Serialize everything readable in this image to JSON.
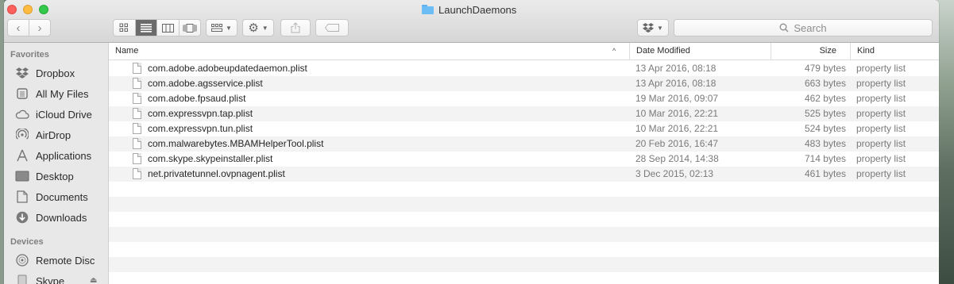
{
  "window": {
    "title": "LaunchDaemons",
    "folder_icon": "folder-icon"
  },
  "toolbar": {
    "back_icon": "chevron-left-icon",
    "forward_icon": "chevron-right-icon",
    "views": [
      "icon-view",
      "list-view",
      "column-view",
      "cover-flow-view"
    ],
    "active_view": "list-view",
    "search_placeholder": "Search"
  },
  "sidebar": {
    "favorites_label": "Favorites",
    "favorites": [
      {
        "label": "Dropbox",
        "icon": "dropbox-icon"
      },
      {
        "label": "All My Files",
        "icon": "all-files-icon"
      },
      {
        "label": "iCloud Drive",
        "icon": "cloud-icon"
      },
      {
        "label": "AirDrop",
        "icon": "airdrop-icon"
      },
      {
        "label": "Applications",
        "icon": "applications-icon"
      },
      {
        "label": "Desktop",
        "icon": "desktop-icon"
      },
      {
        "label": "Documents",
        "icon": "documents-icon"
      },
      {
        "label": "Downloads",
        "icon": "downloads-icon"
      }
    ],
    "devices_label": "Devices",
    "devices": [
      {
        "label": "Remote Disc",
        "icon": "disc-icon"
      },
      {
        "label": "Skype",
        "icon": "drive-icon"
      }
    ]
  },
  "table": {
    "columns": {
      "name": "Name",
      "date": "Date Modified",
      "size": "Size",
      "kind": "Kind"
    },
    "rows": [
      {
        "name": "com.adobe.adobeupdatedaemon.plist",
        "date": "13 Apr 2016, 08:18",
        "size": "479 bytes",
        "kind": "property list"
      },
      {
        "name": "com.adobe.agsservice.plist",
        "date": "13 Apr 2016, 08:18",
        "size": "663 bytes",
        "kind": "property list"
      },
      {
        "name": "com.adobe.fpsaud.plist",
        "date": "19 Mar 2016, 09:07",
        "size": "462 bytes",
        "kind": "property list"
      },
      {
        "name": "com.expressvpn.tap.plist",
        "date": "10 Mar 2016, 22:21",
        "size": "525 bytes",
        "kind": "property list"
      },
      {
        "name": "com.expressvpn.tun.plist",
        "date": "10 Mar 2016, 22:21",
        "size": "524 bytes",
        "kind": "property list"
      },
      {
        "name": "com.malwarebytes.MBAMHelperTool.plist",
        "date": "20 Feb 2016, 16:47",
        "size": "483 bytes",
        "kind": "property list"
      },
      {
        "name": "com.skype.skypeinstaller.plist",
        "date": "28 Sep 2014, 14:38",
        "size": "714 bytes",
        "kind": "property list"
      },
      {
        "name": "net.privatetunnel.ovpnagent.plist",
        "date": "3 Dec 2015, 02:13",
        "size": "461 bytes",
        "kind": "property list"
      }
    ]
  }
}
